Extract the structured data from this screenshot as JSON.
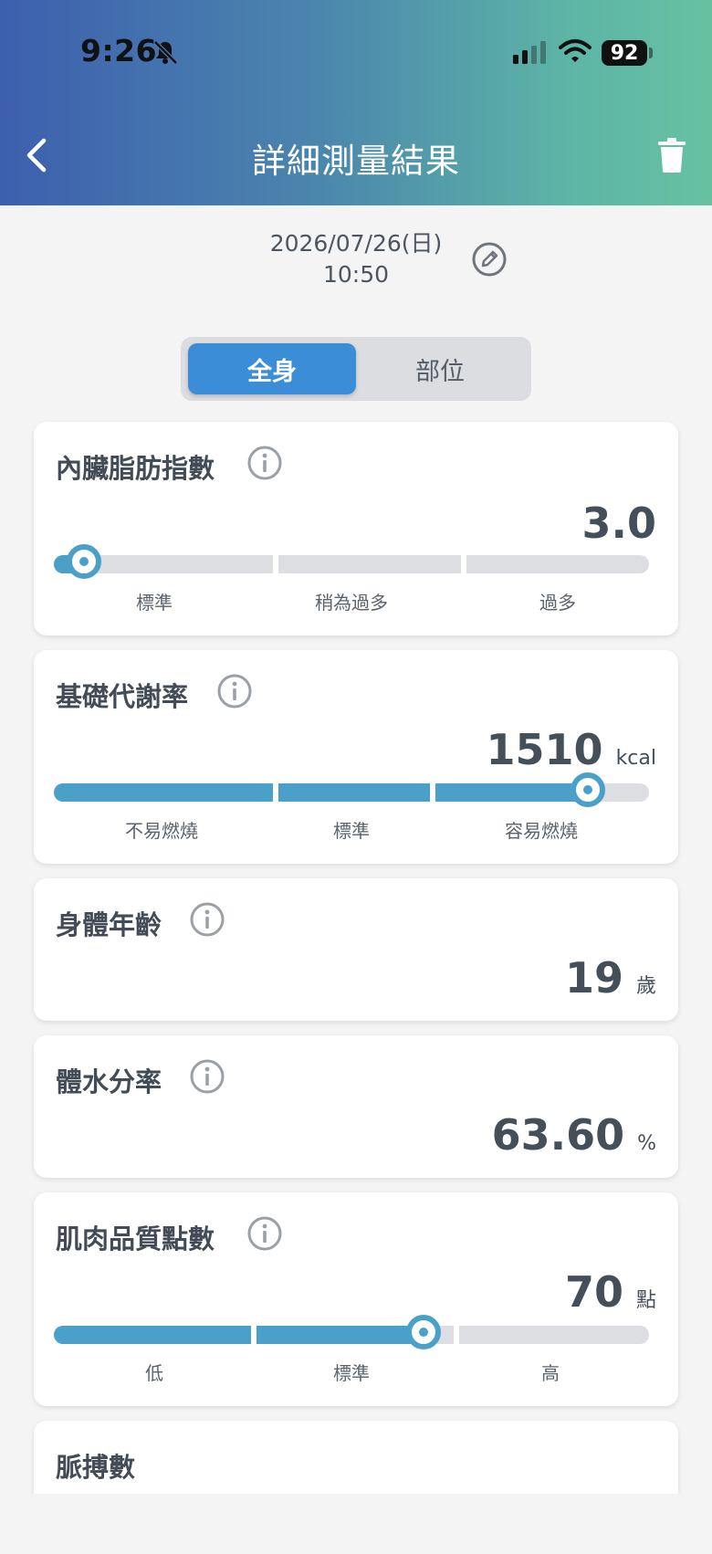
{
  "status_bar": {
    "time": "9:26",
    "battery": "92"
  },
  "header": {
    "title": "詳細測量結果"
  },
  "record": {
    "date": "2026/07/26(日)",
    "time": "10:50"
  },
  "segment": {
    "active": "全身",
    "inactive": "部位"
  },
  "cards": [
    {
      "title": "內臟脂肪指數",
      "value": "3.0",
      "unit": "",
      "labels": [
        "標準",
        "稍為過多",
        "過多"
      ],
      "level": 0.05
    },
    {
      "title": "基礎代謝率",
      "value": "1510",
      "unit": "kcal",
      "labels": [
        "不易燃燒",
        "標準",
        "容易燃燒"
      ],
      "level": 0.896
    },
    {
      "title": "身體年齡",
      "value": "19",
      "unit": "歲"
    },
    {
      "title": "體水分率",
      "value": "63.60",
      "unit": "%"
    },
    {
      "title": "肌肉品質點數",
      "value": "70",
      "unit": "點",
      "labels": [
        "低",
        "標準",
        "高"
      ],
      "level": 0.622
    },
    {
      "title": "脈搏數"
    }
  ],
  "colors": {
    "accent": "#3b8dd7",
    "bar_fill": "#4aa0c8",
    "header_start": "#3d5fae",
    "header_end": "#67c1a1"
  }
}
